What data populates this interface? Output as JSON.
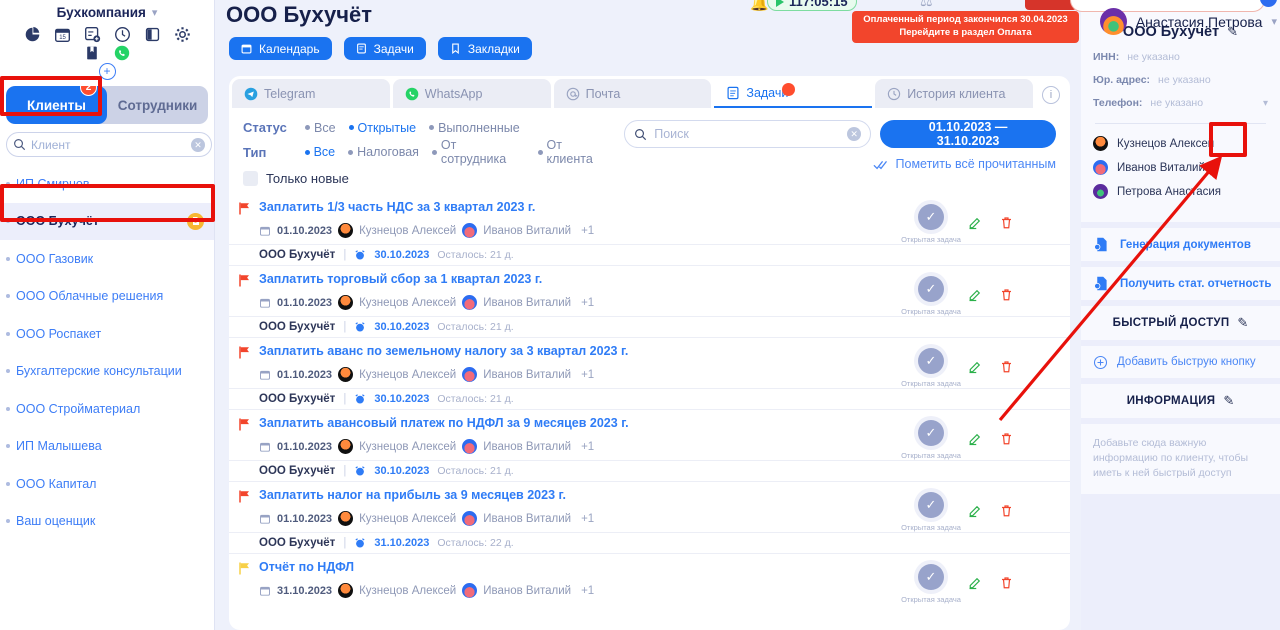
{
  "sidebar": {
    "company_name": "Бухкомпания",
    "toolbar_icons": [
      "chart-pie-icon",
      "calendar-icon",
      "task-add-icon",
      "clock-icon",
      "panel-icon",
      "gear-icon"
    ],
    "toolbar_icons_row2": [
      "book-icon",
      "whatsapp-icon"
    ],
    "add_button": "+",
    "tabs": [
      {
        "label": "Клиенты",
        "active": true,
        "badge": "2"
      },
      {
        "label": "Сотрудники",
        "active": false,
        "badge": ""
      }
    ],
    "search": {
      "placeholder": "Клиент",
      "value": ""
    },
    "clients": [
      {
        "label": "ИП Смирнов",
        "selected": false,
        "badge": false
      },
      {
        "label": "ООО Бухучёт",
        "selected": true,
        "badge": true
      },
      {
        "label": "ООО Газовик",
        "selected": false,
        "badge": false
      },
      {
        "label": "ООО Облачные решения",
        "selected": false,
        "badge": false
      },
      {
        "label": "ООО Роспакет",
        "selected": false,
        "badge": false
      },
      {
        "label": "Бухгалтерские консультации",
        "selected": false,
        "badge": false
      },
      {
        "label": "ООО Стройматериал",
        "selected": false,
        "badge": false
      },
      {
        "label": "ИП Малышева",
        "selected": false,
        "badge": false
      },
      {
        "label": "ООО Капитал",
        "selected": false,
        "badge": false
      },
      {
        "label": "Ваш оценщик",
        "selected": false,
        "badge": false
      }
    ]
  },
  "topbar": {
    "timer": "117:05:15",
    "alert_line1": "Оплаченный период закончился 30.04.2023",
    "alert_line2": "Перейдите в раздел Оплата",
    "user_name": "Анастасия Петрова"
  },
  "main": {
    "title": "ООО Бухучёт",
    "quick_buttons": [
      {
        "label": "Календарь",
        "icon": "calendar-icon"
      },
      {
        "label": "Задачи",
        "icon": "tasks-icon"
      },
      {
        "label": "Закладки",
        "icon": "bookmark-icon"
      }
    ],
    "channel_tabs": [
      {
        "label": "Telegram",
        "icon": "telegram-icon",
        "active": false,
        "dot": false
      },
      {
        "label": "WhatsApp",
        "icon": "whatsapp-icon",
        "active": false,
        "dot": false
      },
      {
        "label": "Почта",
        "icon": "mail-icon",
        "active": false,
        "dot": false
      },
      {
        "label": "Задачи",
        "icon": "tasks-icon",
        "active": true,
        "dot": true
      },
      {
        "label": "История клиента",
        "icon": "history-icon",
        "active": false,
        "dot": false
      }
    ],
    "filters": {
      "status_label": "Статус",
      "status_options": [
        {
          "label": "Все",
          "on": false
        },
        {
          "label": "Открытые",
          "on": true
        },
        {
          "label": "Выполненные",
          "on": false
        }
      ],
      "type_label": "Тип",
      "type_options": [
        {
          "label": "Все",
          "on": true
        },
        {
          "label": "Налоговая",
          "on": false
        },
        {
          "label": "От сотрудника",
          "on": false
        },
        {
          "label": "От клиента",
          "on": false
        }
      ],
      "only_new_label": "Только новые",
      "only_new_checked": false
    },
    "search": {
      "placeholder": "Поиск",
      "value": ""
    },
    "date_range": "01.10.2023 — 31.10.2023",
    "mark_all_read": "Пометить всё прочитанным",
    "tasks": [
      {
        "flag": "red",
        "title": "Заплатить 1/3 часть НДС за 3 квартал 2023 г.",
        "date": "01.10.2023",
        "assignee1": "Кузнецов Алексей",
        "assignee2": "Иванов Виталий",
        "more": "+1",
        "status_label": "Открытая задача",
        "org": "ООО Бухучёт",
        "deadline": "30.10.2023",
        "left": "Осталось: 21 д."
      },
      {
        "flag": "red",
        "title": "Заплатить торговый сбор за 1 квартал 2023 г.",
        "date": "01.10.2023",
        "assignee1": "Кузнецов Алексей",
        "assignee2": "Иванов Виталий",
        "more": "+1",
        "status_label": "Открытая задача",
        "org": "ООО Бухучёт",
        "deadline": "30.10.2023",
        "left": "Осталось: 21 д."
      },
      {
        "flag": "red",
        "title": "Заплатить аванс по земельному налогу за 3 квартал 2023 г.",
        "date": "01.10.2023",
        "assignee1": "Кузнецов Алексей",
        "assignee2": "Иванов Виталий",
        "more": "+1",
        "status_label": "Открытая задача",
        "org": "ООО Бухучёт",
        "deadline": "30.10.2023",
        "left": "Осталось: 21 д."
      },
      {
        "flag": "red",
        "title": "Заплатить авансовый платеж по НДФЛ за 9 месяцев 2023 г.",
        "date": "01.10.2023",
        "assignee1": "Кузнецов Алексей",
        "assignee2": "Иванов Виталий",
        "more": "+1",
        "status_label": "Открытая задача",
        "org": "ООО Бухучёт",
        "deadline": "30.10.2023",
        "left": "Осталось: 21 д."
      },
      {
        "flag": "red",
        "title": "Заплатить налог на прибыль за 9 месяцев 2023 г.",
        "date": "01.10.2023",
        "assignee1": "Кузнецов Алексей",
        "assignee2": "Иванов Виталий",
        "more": "+1",
        "status_label": "Открытая задача",
        "org": "ООО Бухучёт",
        "deadline": "31.10.2023",
        "left": "Осталось: 22 д."
      },
      {
        "flag": "yellow",
        "title": "Отчёт по НДФЛ",
        "date": "31.10.2023",
        "assignee1": "Кузнецов Алексей",
        "assignee2": "Иванов Виталий",
        "more": "+1",
        "status_label": "Открытая задача",
        "org": "",
        "deadline": "",
        "left": ""
      }
    ]
  },
  "right": {
    "title": "ООО Бухучёт",
    "fields": [
      {
        "key": "ИНН:",
        "value": "не указано"
      },
      {
        "key": "Юр. адрес:",
        "value": "не указано"
      },
      {
        "key": "Телефон:",
        "value": "не указано"
      }
    ],
    "people": [
      {
        "name": "Кузнецов Алексей"
      },
      {
        "name": "Иванов Виталий"
      },
      {
        "name": "Петрова Анастасия"
      }
    ],
    "action_buttons": [
      {
        "label": "Генерация документов",
        "icon": "document-gear-icon"
      },
      {
        "label": "Получить стат. отчетность",
        "icon": "document-gear-icon"
      }
    ],
    "quick_access_title": "БЫСТРЫЙ ДОСТУП",
    "add_quick_button": "Добавить быструю кнопку",
    "information_title": "ИНФОРМАЦИЯ",
    "information_placeholder": "Добавьте сюда важную информацию по клиенту, чтобы иметь к ней быстрый доступ"
  },
  "colors": {
    "accent": "#1a73f0",
    "danger": "#f2452c",
    "annotation": "#e8110b",
    "link": "#2f7cf6",
    "badge": "#f7b731"
  }
}
